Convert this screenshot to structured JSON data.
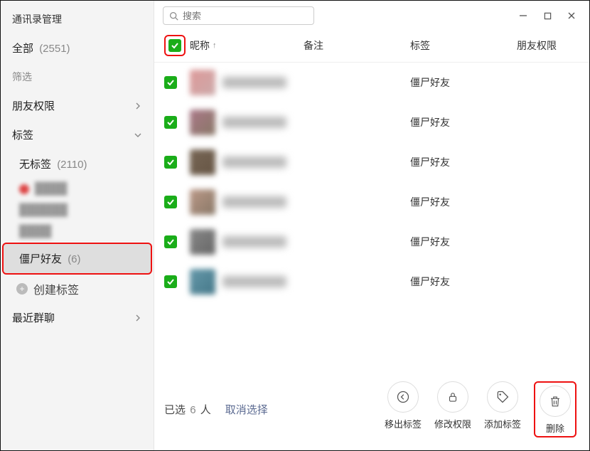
{
  "app_title": "通讯录管理",
  "sidebar": {
    "all_label": "全部",
    "all_count": "(2551)",
    "filter_label": "筛选",
    "perm_label": "朋友权限",
    "tags_label": "标签",
    "no_tag_label": "无标签",
    "no_tag_count": "(2110)",
    "sel_tag_label": "僵尸好友",
    "sel_tag_count": "(6)",
    "create_tag": "创建标签",
    "recent_group": "最近群聊"
  },
  "search": {
    "placeholder": "搜索"
  },
  "columns": {
    "nick": "昵称",
    "remark": "备注",
    "tag": "标签",
    "perm": "朋友权限"
  },
  "rows": [
    {
      "tag": "僵尸好友"
    },
    {
      "tag": "僵尸好友"
    },
    {
      "tag": "僵尸好友"
    },
    {
      "tag": "僵尸好友"
    },
    {
      "tag": "僵尸好友"
    },
    {
      "tag": "僵尸好友"
    }
  ],
  "footer": {
    "selected_prefix": "已选",
    "selected_count": "6",
    "selected_suffix": "人",
    "cancel": "取消选择",
    "remove_tag": "移出标签",
    "edit_perm": "修改权限",
    "add_tag": "添加标签",
    "delete": "删除"
  }
}
